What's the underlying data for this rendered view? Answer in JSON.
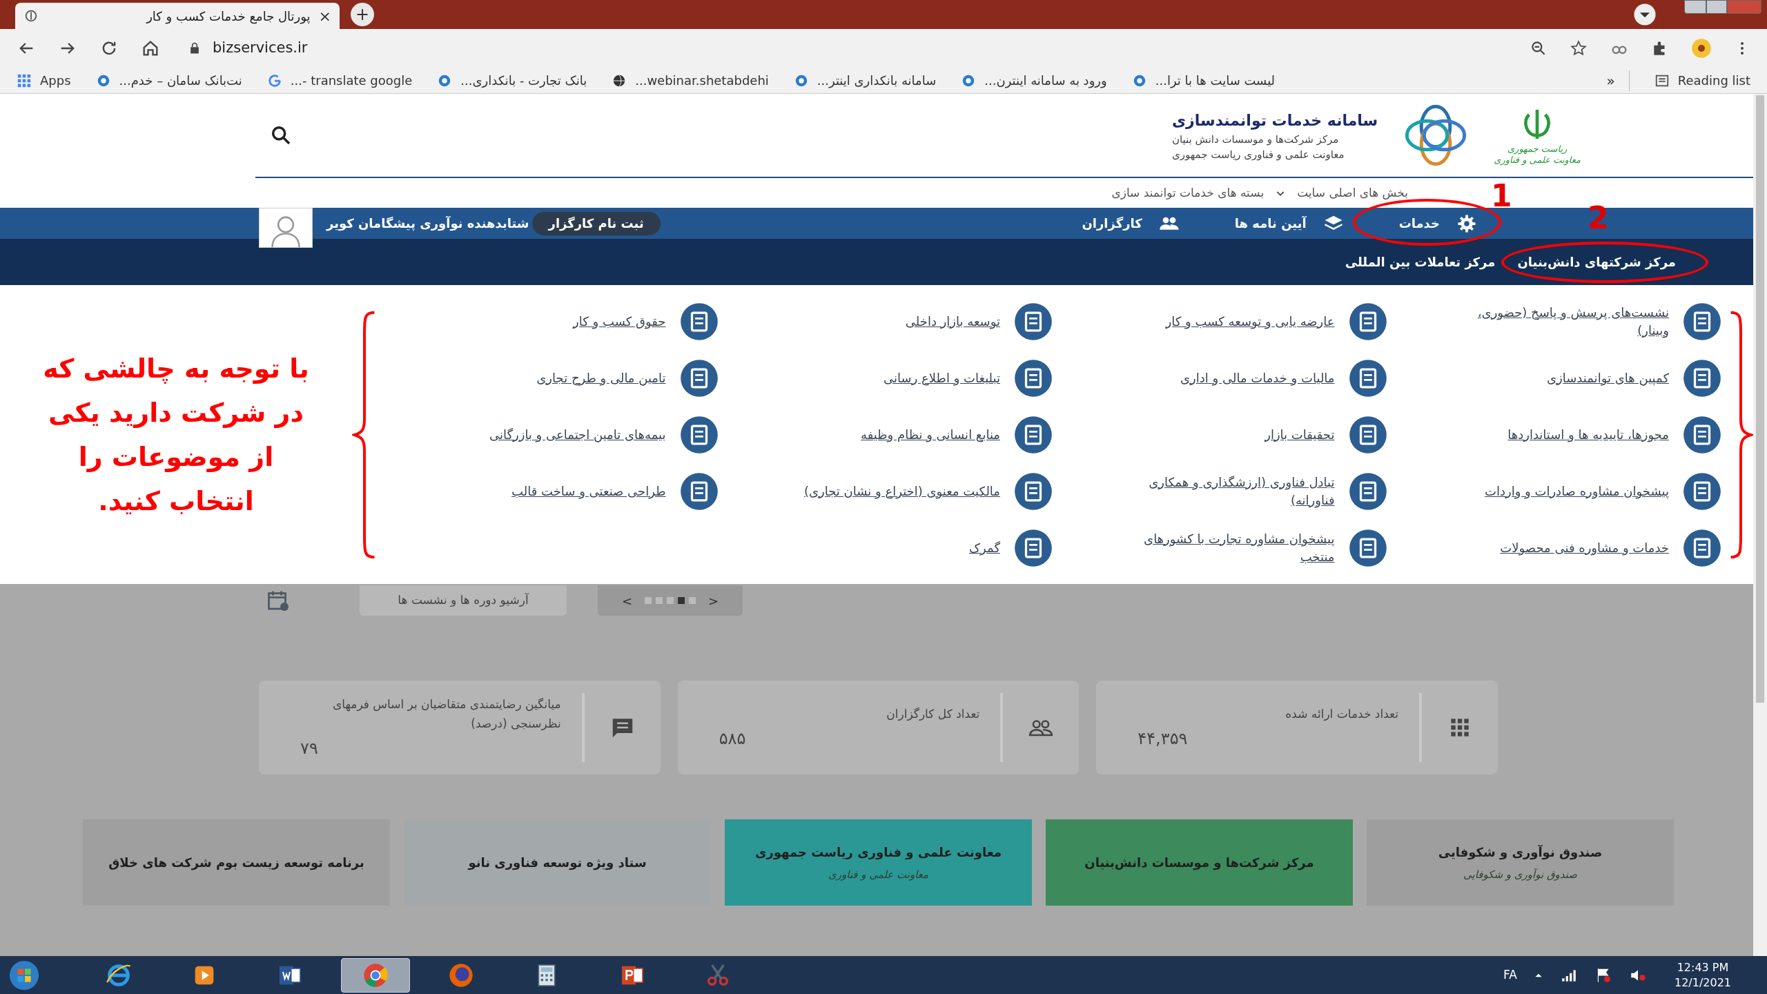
{
  "browser": {
    "tab_title": "پورتال جامع خدمات کسب و کار",
    "tab_close": "×",
    "new_tab": "+",
    "url": "bizservices.ir",
    "bookmarks": [
      {
        "label": "لیست سایت ها با ترا...",
        "kind": "bank"
      },
      {
        "label": "ورود به سامانه اینترن...",
        "kind": "bank"
      },
      {
        "label": "سامانه بانکداری اینتر...",
        "kind": "bank"
      },
      {
        "label": "webinar.shetabdehi...",
        "kind": "globe"
      },
      {
        "label": "بانک تجارت - بانکداری...",
        "kind": "bank"
      },
      {
        "label": "translate google -...",
        "kind": "google"
      },
      {
        "label": "نت‌بانک سامان – خدم...",
        "kind": "bank"
      },
      {
        "label": "Apps",
        "kind": "apps"
      }
    ],
    "bookmarks_more": "»",
    "reading_list": "Reading list"
  },
  "header": {
    "title": "سامانه خدمات توانمندسازی",
    "subtitle_lines": [
      "مرکز شرکت‌ها و موسسات دانش بنیان",
      "معاونت علمی و فناوری ریاست جمهوری"
    ],
    "emblem_lines": [
      "ریاست جمهوری",
      "معاونت علمی و فناوری"
    ]
  },
  "breadcrumb": [
    "بخش های اصلی سایت",
    "بسته های خدمات توانمند سازی"
  ],
  "nav": {
    "items": [
      {
        "label": "خدمات",
        "kind": "gear"
      },
      {
        "label": "آیین نامه ها",
        "kind": "layers"
      },
      {
        "label": "کارگزاران",
        "kind": "people"
      }
    ],
    "user_name": "شتابدهنده نوآوری پیشگامان کویر",
    "register_button": "ثبت نام کارگزار"
  },
  "submenu": [
    "مرکز شرکتهای دانش‌بنیان",
    "مرکز تعاملات بین المللی"
  ],
  "annotations": {
    "instruction": "با توجه به چالشی که در شرکت دارید یکی از موضوعات را انتخاب کنید.",
    "markers": [
      "1",
      "2"
    ]
  },
  "services": [
    "نشست‌های پرسش و پاسخ (حضوری، وبینار)",
    "عارضه یابی و توسعه کسب و کار",
    "توسعه بازار داخلی",
    "حقوق کسب و کار",
    "کمپین های توانمندسازی",
    "مالیات و خدمات مالی و اداری",
    "تبلیغات و اطلاع رسانی",
    "تامین مالی و طرح تجاری",
    "مجوزها، تاییدیه ها و استانداردها",
    "تحقیقات بازار",
    "منابع انسانی و نظام وظیفه",
    "بیمه‌های تامین اجتماعی و بازرگانی",
    "پیشخوان مشاوره صادرات و واردات",
    "تبادل فناوری (ارزشگذاری و همکاری فناورانه)",
    "مالکیت معنوی (اختراع و نشان تجاری)",
    "طراحی صنعتی و ساخت قالب",
    "خدمات و مشاوره فنی محصولات",
    "پیشخوان مشاوره تجارت با کشورهای منتخب",
    "گمرک"
  ],
  "archive_button": "آرشیو دوره ها و نشست ها",
  "pager": {
    "prev": "<",
    "next": ">",
    "dots": [
      {
        "selected": false
      },
      {
        "selected": false
      },
      {
        "selected": false
      },
      {
        "selected": true
      },
      {
        "selected": false
      }
    ]
  },
  "stats": [
    {
      "label": "تعداد خدمات ارائه شده",
      "value": "۴۴,۳۵۹",
      "kind": "grid"
    },
    {
      "label": "تعداد کل کارگزاران",
      "value": "۵۸۵",
      "kind": "people"
    },
    {
      "label": "میانگین رضایتمندی متقاضیان بر اساس فرمهای نظرسنجی (درصد)",
      "value": "۷۹",
      "kind": "chat"
    }
  ],
  "banners": [
    {
      "label": "صندوق نوآوری و شکوفایی",
      "caption": "صندوق نوآوری و شکوفایی",
      "color": "#9e9e9e"
    },
    {
      "label": "مرکز شرکت‌ها و موسسات دانش‌بنیان",
      "color": "#3d8a5c"
    },
    {
      "label": "معاونت علمی و فناوری ریاست جمهوری",
      "caption": "معاونت علمی و فناوری",
      "color": "#2b9896"
    },
    {
      "label": "ستاد ویژه توسعه فناوری نانو",
      "color": "#a3a9ab"
    },
    {
      "label": "برنامه توسعه زیست بوم شرکت های خلاق",
      "color": "#9f9f9f"
    }
  ],
  "taskbar": {
    "apps": [
      {
        "kind": "ie",
        "selected": false
      },
      {
        "kind": "media",
        "selected": false
      },
      {
        "kind": "word",
        "selected": false
      },
      {
        "kind": "chrome",
        "selected": true
      },
      {
        "kind": "firefox",
        "selected": false
      },
      {
        "kind": "calculator",
        "selected": false
      },
      {
        "kind": "powerpoint",
        "selected": false
      },
      {
        "kind": "snipping",
        "selected": false
      }
    ],
    "language": "FA",
    "time": "12:43 PM",
    "date": "12/1/2021"
  }
}
